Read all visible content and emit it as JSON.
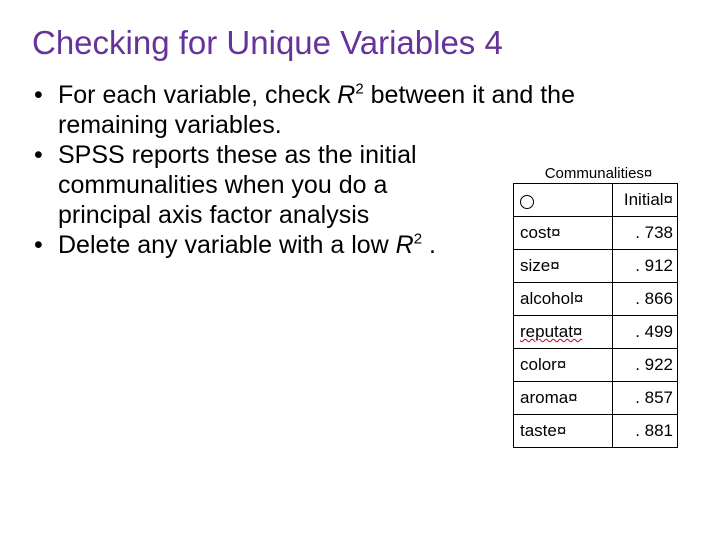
{
  "title": "Checking for Unique Variables 4",
  "bullets": {
    "b1_pre": "For each variable, check ",
    "b1_r": "R",
    "b1_sup": "2",
    "b1_post": " between it and the remaining variables.",
    "b2": "SPSS reports these as the initial communalities when you do a principal axis factor analysis",
    "b3_pre": "Delete any variable with a low ",
    "b3_r": "R",
    "b3_sup": "2",
    "b3_post": " ."
  },
  "table": {
    "title": "Communalities¤",
    "header_initial": "Initial¤",
    "rows": [
      {
        "name": "cost¤",
        "value": ". 738",
        "squiggle": false
      },
      {
        "name": "size¤",
        "value": ". 912",
        "squiggle": false
      },
      {
        "name": "alcohol¤",
        "value": ". 866",
        "squiggle": false
      },
      {
        "name": "reputat¤",
        "value": ". 499",
        "squiggle": true
      },
      {
        "name": "color¤",
        "value": ". 922",
        "squiggle": false
      },
      {
        "name": "aroma¤",
        "value": ". 857",
        "squiggle": false
      },
      {
        "name": "taste¤",
        "value": ". 881",
        "squiggle": false
      }
    ]
  }
}
